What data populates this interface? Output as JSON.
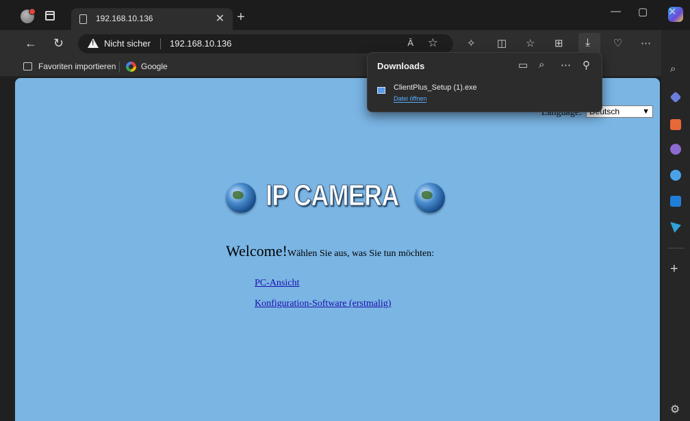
{
  "browser": {
    "tab": {
      "title": "192.168.10.136",
      "close_glyph": "✕"
    },
    "new_tab_glyph": "+",
    "window_controls": {
      "minimize": "—",
      "maximize": "▢",
      "close": "✕"
    },
    "nav": {
      "back": "←",
      "refresh": "↻"
    },
    "address": {
      "security_label": "Nicht sicher",
      "url": "192.168.10.136",
      "read_aloud": "Ā",
      "favorite": "☆"
    },
    "toolbar_icons": [
      "extensions-icon",
      "split-screen-icon",
      "favorites-icon",
      "collections-icon",
      "downloads-icon",
      "browser-essentials-icon",
      "more-icon"
    ],
    "favorites_bar": {
      "import": "Favoriten importieren",
      "google": "Google"
    }
  },
  "downloads": {
    "title": "Downloads",
    "file_name": "ClientPlus_Setup (1).exe",
    "open_label": "Datei öffnen"
  },
  "page": {
    "language_label": "Language:",
    "language_value": "Deutsch",
    "logo_text": "IP CAMERA",
    "welcome": "Welcome!",
    "welcome_sub": "Wählen Sie aus, was Sie tun möchten:",
    "links": [
      "PC-Ansicht",
      "Konfiguration-Software (erstmalig)"
    ]
  },
  "sidebar": {
    "icons": [
      "search-icon",
      "tag-icon",
      "toolbox-icon",
      "people-icon",
      "copilot-sidebar-icon",
      "outlook-icon",
      "send-icon"
    ],
    "add_label": "+",
    "settings_glyph": "⚙"
  },
  "colors": {
    "page_bg": "#7ab5e4",
    "link": "#1a0dab",
    "chrome_dark": "#202020"
  }
}
